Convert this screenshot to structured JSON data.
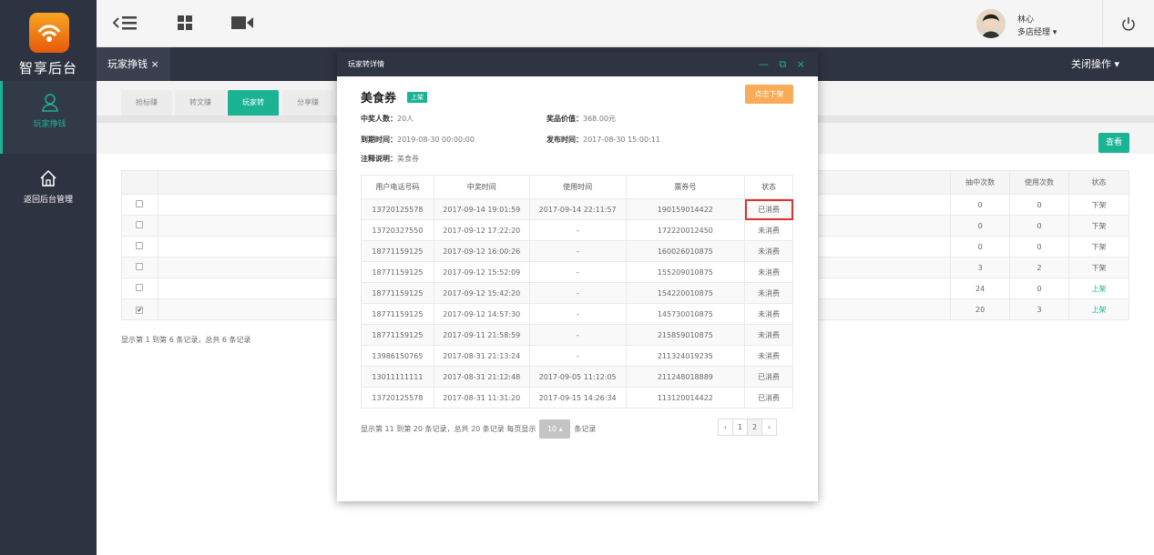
{
  "brand": {
    "name": "智享后台"
  },
  "sidebar": {
    "items": [
      {
        "label": "玩家挣钱",
        "icon": "user-icon",
        "active": true
      },
      {
        "label": "返回后台管理",
        "icon": "home-icon",
        "active": false
      }
    ]
  },
  "topbar": {
    "icons": [
      "menu-collapse-icon",
      "grid-icon",
      "video-icon"
    ],
    "user": {
      "name": "林心",
      "role": "多店经理 ▾"
    },
    "power_icon": "power-icon"
  },
  "tabbar": {
    "tab_label": "玩家挣钱 ×",
    "close_ops": "关闭操作 ▾"
  },
  "subtabs": [
    "抢标赚",
    "转文赚",
    "玩家转",
    "分享赚"
  ],
  "background": {
    "view_button": "查看",
    "headers": [
      "抽中次数",
      "使用次数",
      "状态"
    ],
    "rows": [
      {
        "checked": false,
        "draws": "0",
        "uses": "0",
        "status": "下架"
      },
      {
        "checked": false,
        "draws": "0",
        "uses": "0",
        "status": "下架"
      },
      {
        "checked": false,
        "draws": "0",
        "uses": "0",
        "status": "下架"
      },
      {
        "checked": false,
        "draws": "3",
        "uses": "2",
        "status": "下架"
      },
      {
        "checked": false,
        "draws": "24",
        "uses": "0",
        "status": "上架"
      },
      {
        "checked": true,
        "draws": "20",
        "uses": "3",
        "status": "上架"
      }
    ],
    "note": "显示第 1 到第 6 条记录，总共 6 条记录"
  },
  "modal": {
    "title": "玩家转详情",
    "controls": "— ⧉ ×",
    "item_name": "美食券",
    "badge": "上架",
    "off_button": "点击下架",
    "winners_label": "中奖人数：",
    "winners_value": "20人",
    "prize_label": "奖品价值：",
    "prize_value": "368.00元",
    "expire_label": "到期时间：",
    "expire_value": "2019-08-30 00:00:00",
    "publish_label": "发布时间：",
    "publish_value": "2017-08-30 15:00:11",
    "note_label": "注释说明：",
    "note_value": "美食券",
    "headers": [
      "用户电话号码",
      "中奖时间",
      "使用时间",
      "票券号",
      "状态"
    ],
    "rows": [
      [
        "13720125578",
        "2017-09-14 19:01:59",
        "2017-09-14 22:11:57",
        "190159014422",
        "已消费"
      ],
      [
        "13720327550",
        "2017-09-12 17:22:20",
        "-",
        "172220012450",
        "未消费"
      ],
      [
        "18771159125",
        "2017-09-12 16:00:26",
        "-",
        "160026010875",
        "未消费"
      ],
      [
        "18771159125",
        "2017-09-12 15:52:09",
        "-",
        "155209010875",
        "未消费"
      ],
      [
        "18771159125",
        "2017-09-12 15:42:20",
        "-",
        "154220010875",
        "未消费"
      ],
      [
        "18771159125",
        "2017-09-12 14:57:30",
        "-",
        "145730010875",
        "未消费"
      ],
      [
        "18771159125",
        "2017-09-11 21:58:59",
        "-",
        "215859010875",
        "未消费"
      ],
      [
        "13986150765",
        "2017-08-31 21:13:24",
        "-",
        "211324019235",
        "未消费"
      ],
      [
        "13011111111",
        "2017-08-31 21:12:48",
        "2017-09-05 11:12:05",
        "211248018889",
        "已消费"
      ],
      [
        "13720125578",
        "2017-08-31 11:31:20",
        "2017-09-15 14:26:34",
        "113120014422",
        "已消费"
      ]
    ],
    "footer_prefix": "显示第 11 到第 20 条记录，总共 20 条记录 每页显示",
    "page_size": "10 ▴",
    "footer_suffix": "条记录",
    "pager": [
      "‹",
      "1",
      "2",
      "›"
    ]
  },
  "colors": {
    "accent": "#1ab394",
    "sidebar": "#2e3341",
    "warn": "#f8ac59",
    "highlight": "#e03030"
  }
}
